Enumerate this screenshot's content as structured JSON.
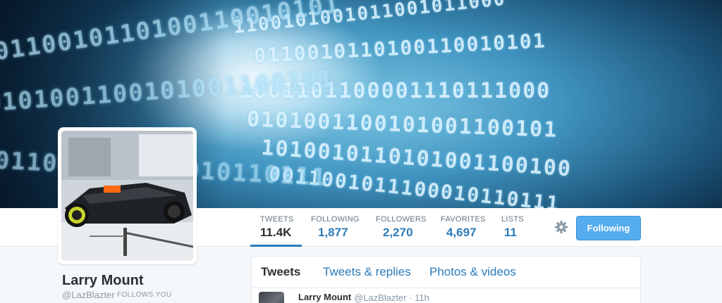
{
  "profile": {
    "name": "Larry Mount",
    "handle": "@LazBlazter",
    "follows_you": "FOLLOWS YOU"
  },
  "stats": [
    {
      "label": "TWEETS",
      "value": "11.4K",
      "active": true
    },
    {
      "label": "FOLLOWING",
      "value": "1,877",
      "active": false
    },
    {
      "label": "FOLLOWERS",
      "value": "2,270",
      "active": false
    },
    {
      "label": "FAVORITES",
      "value": "4,697",
      "active": false
    },
    {
      "label": "LISTS",
      "value": "11",
      "active": false
    }
  ],
  "actions": {
    "gear_icon": "gear-icon",
    "follow_label": "Following"
  },
  "timeline": {
    "tabs": [
      {
        "label": "Tweets",
        "active": true
      },
      {
        "label": "Tweets & replies",
        "active": false
      },
      {
        "label": "Photos & videos",
        "active": false
      }
    ],
    "tweet": {
      "author": "Larry Mount",
      "handle_time": "@LazBlazter · 11h"
    }
  },
  "banner_text": {
    "binary_rows": [
      "1100101001011001011000",
      "0110010110100110010101",
      "1001101100001110111000",
      "0101001100101001100101",
      "1010010110101001100100",
      "0011001011100010110111"
    ]
  },
  "colors": {
    "accent": "#2b7bb9",
    "follow_button": "#55acee",
    "text": "#292f33",
    "muted": "#8899a6"
  }
}
